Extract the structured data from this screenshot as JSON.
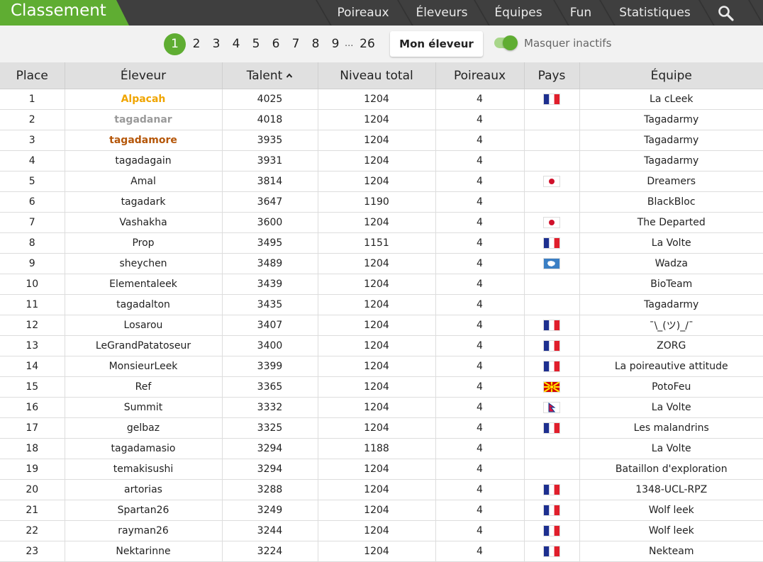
{
  "header": {
    "title": "Classement",
    "nav": [
      "Poireaux",
      "Éleveurs",
      "Équipes",
      "Fun",
      "Statistiques"
    ]
  },
  "pagination": {
    "pages": [
      "1",
      "2",
      "3",
      "4",
      "5",
      "6",
      "7",
      "8",
      "9"
    ],
    "ellipsis": "...",
    "last": "26",
    "current": "1"
  },
  "controls": {
    "mon_eleveur": "Mon éleveur",
    "toggle_label": "Masquer inactifs",
    "toggle_on": true
  },
  "table": {
    "columns": [
      "Place",
      "Éleveur",
      "Talent",
      "Niveau total",
      "Poireaux",
      "Pays",
      "Équipe"
    ],
    "sorted_by": "Talent",
    "rows": [
      {
        "place": "1",
        "name": "Alpacah",
        "talent": "4025",
        "level": "1204",
        "leeks": "4",
        "flag": "fr",
        "team": "La cLeek"
      },
      {
        "place": "2",
        "name": "tagadanar",
        "talent": "4018",
        "level": "1204",
        "leeks": "4",
        "flag": "",
        "team": "Tagadarmy"
      },
      {
        "place": "3",
        "name": "tagadamore",
        "talent": "3935",
        "level": "1204",
        "leeks": "4",
        "flag": "",
        "team": "Tagadarmy"
      },
      {
        "place": "4",
        "name": "tagadagain",
        "talent": "3931",
        "level": "1204",
        "leeks": "4",
        "flag": "",
        "team": "Tagadarmy"
      },
      {
        "place": "5",
        "name": "Amal",
        "talent": "3814",
        "level": "1204",
        "leeks": "4",
        "flag": "jp",
        "team": "Dreamers"
      },
      {
        "place": "6",
        "name": "tagadark",
        "talent": "3647",
        "level": "1190",
        "leeks": "4",
        "flag": "",
        "team": "BlackBloc"
      },
      {
        "place": "7",
        "name": "Vashakha",
        "talent": "3600",
        "level": "1204",
        "leeks": "4",
        "flag": "jp",
        "team": "The Departed"
      },
      {
        "place": "8",
        "name": "Prop",
        "talent": "3495",
        "level": "1151",
        "leeks": "4",
        "flag": "fr",
        "team": "La Volte"
      },
      {
        "place": "9",
        "name": "sheychen",
        "talent": "3489",
        "level": "1204",
        "leeks": "4",
        "flag": "aq",
        "team": "Wadza"
      },
      {
        "place": "10",
        "name": "Elementaleek",
        "talent": "3439",
        "level": "1204",
        "leeks": "4",
        "flag": "",
        "team": "BioTeam"
      },
      {
        "place": "11",
        "name": "tagadalton",
        "talent": "3435",
        "level": "1204",
        "leeks": "4",
        "flag": "",
        "team": "Tagadarmy"
      },
      {
        "place": "12",
        "name": "Losarou",
        "talent": "3407",
        "level": "1204",
        "leeks": "4",
        "flag": "fr",
        "team": "¯\\_(ツ)_/¯"
      },
      {
        "place": "13",
        "name": "LeGrandPatatoseur",
        "talent": "3400",
        "level": "1204",
        "leeks": "4",
        "flag": "fr",
        "team": "ZORG"
      },
      {
        "place": "14",
        "name": "MonsieurLeek",
        "talent": "3399",
        "level": "1204",
        "leeks": "4",
        "flag": "fr",
        "team": "La poireautive attitude"
      },
      {
        "place": "15",
        "name": "Ref",
        "talent": "3365",
        "level": "1204",
        "leeks": "4",
        "flag": "mk",
        "team": "PotoFeu"
      },
      {
        "place": "16",
        "name": "Summit",
        "talent": "3332",
        "level": "1204",
        "leeks": "4",
        "flag": "np",
        "team": "La Volte"
      },
      {
        "place": "17",
        "name": "gelbaz",
        "talent": "3325",
        "level": "1204",
        "leeks": "4",
        "flag": "fr",
        "team": "Les malandrins"
      },
      {
        "place": "18",
        "name": "tagadamasio",
        "talent": "3294",
        "level": "1188",
        "leeks": "4",
        "flag": "",
        "team": "La Volte"
      },
      {
        "place": "19",
        "name": "temakisushi",
        "talent": "3294",
        "level": "1204",
        "leeks": "4",
        "flag": "",
        "team": "Bataillon d'exploration"
      },
      {
        "place": "20",
        "name": "artorias",
        "talent": "3288",
        "level": "1204",
        "leeks": "4",
        "flag": "fr",
        "team": "1348-UCL-RPZ"
      },
      {
        "place": "21",
        "name": "Spartan26",
        "talent": "3249",
        "level": "1204",
        "leeks": "4",
        "flag": "fr",
        "team": "Wolf leek"
      },
      {
        "place": "22",
        "name": "rayman26",
        "talent": "3244",
        "level": "1204",
        "leeks": "4",
        "flag": "fr",
        "team": "Wolf leek"
      },
      {
        "place": "23",
        "name": "Nektarinne",
        "talent": "3224",
        "level": "1204",
        "leeks": "4",
        "flag": "fr",
        "team": "Nekteam"
      }
    ]
  },
  "colors": {
    "accent": "#5fad32",
    "header_bg": "#3f3f3f",
    "gold": "#f0a500",
    "silver": "#9a9a9a",
    "bronze": "#b5570a"
  }
}
